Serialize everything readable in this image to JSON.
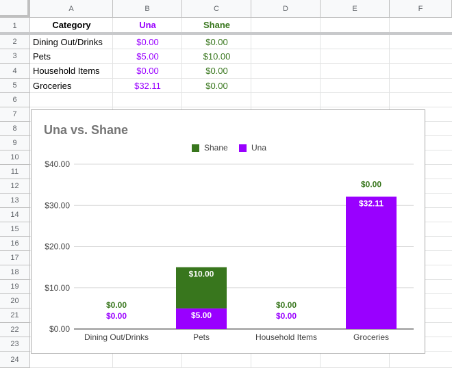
{
  "columns": [
    "A",
    "B",
    "C",
    "D",
    "E",
    "F"
  ],
  "rows": [
    "1",
    "2",
    "3",
    "4",
    "5",
    "6",
    "7",
    "8",
    "9",
    "10",
    "11",
    "12",
    "13",
    "14",
    "15",
    "16",
    "17",
    "18",
    "19",
    "20",
    "21",
    "22",
    "23",
    "24"
  ],
  "table": {
    "header": {
      "category": "Category",
      "una": "Una",
      "shane": "Shane"
    },
    "rows": [
      {
        "category": "Dining Out/Drinks",
        "una": "$0.00",
        "shane": "$0.00"
      },
      {
        "category": "Pets",
        "una": "$5.00",
        "shane": "$10.00"
      },
      {
        "category": "Household Items",
        "una": "$0.00",
        "shane": "$0.00"
      },
      {
        "category": "Groceries",
        "una": "$32.11",
        "shane": "$0.00"
      }
    ]
  },
  "colors": {
    "una": "#9900ff",
    "shane": "#38761d",
    "title": "#757575",
    "axis_text": "#444444"
  },
  "chart_data": {
    "type": "bar",
    "stacked": true,
    "title": "Una vs. Shane",
    "categories": [
      "Dining Out/Drinks",
      "Pets",
      "Household Items",
      "Groceries"
    ],
    "series": [
      {
        "name": "Una",
        "values": [
          0,
          5,
          0,
          32.11
        ],
        "labels": [
          "$0.00",
          "$5.00",
          "$0.00",
          "$32.11"
        ]
      },
      {
        "name": "Shane",
        "values": [
          0,
          10,
          0,
          0
        ],
        "labels": [
          "$0.00",
          "$10.00",
          "$0.00",
          "$0.00"
        ]
      }
    ],
    "legend": [
      "Shane",
      "Una"
    ],
    "legend_position": "top",
    "y_ticks": [
      "$0.00",
      "$10.00",
      "$20.00",
      "$30.00",
      "$40.00"
    ],
    "ylim": [
      0,
      40
    ],
    "grid": true
  }
}
